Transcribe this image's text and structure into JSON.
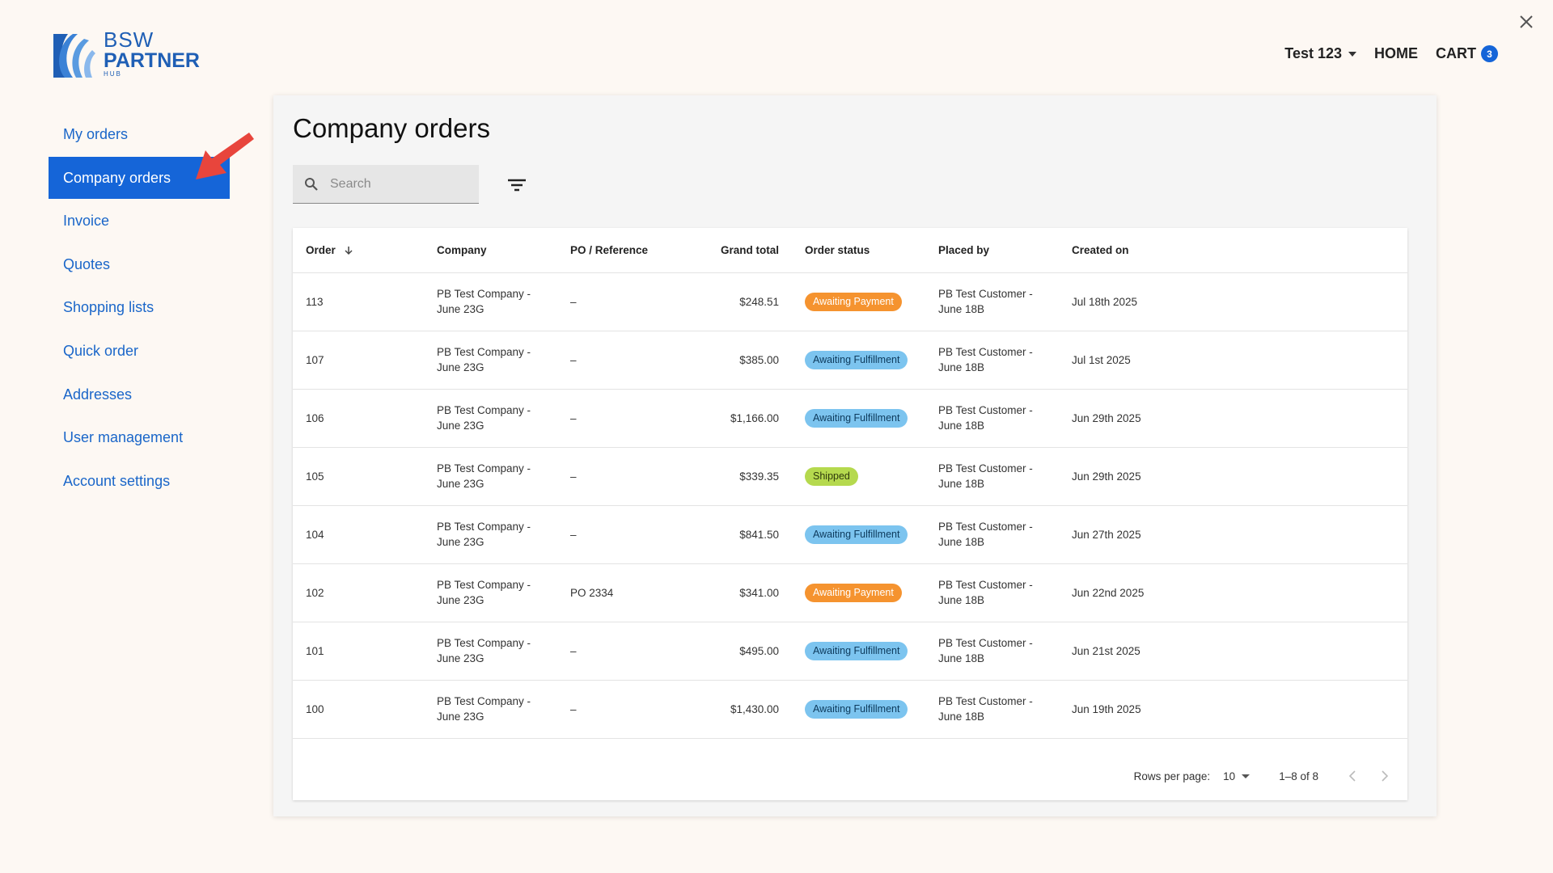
{
  "logo": {
    "line1": "BSW",
    "line2": "PARTNER",
    "line3": "HUB"
  },
  "header": {
    "user_name": "Test 123",
    "home_label": "HOME",
    "cart_label": "CART",
    "cart_count": "3"
  },
  "sidebar": {
    "items": [
      {
        "label": "My orders",
        "active": false
      },
      {
        "label": "Company orders",
        "active": true
      },
      {
        "label": "Invoice",
        "active": false
      },
      {
        "label": "Quotes",
        "active": false
      },
      {
        "label": "Shopping lists",
        "active": false
      },
      {
        "label": "Quick order",
        "active": false
      },
      {
        "label": "Addresses",
        "active": false
      },
      {
        "label": "User management",
        "active": false
      },
      {
        "label": "Account settings",
        "active": false
      }
    ]
  },
  "main": {
    "title": "Company orders",
    "search": {
      "placeholder": "Search",
      "value": ""
    },
    "table": {
      "columns": [
        "Order",
        "Company",
        "PO / Reference",
        "Grand total",
        "Order status",
        "Placed by",
        "Created on"
      ],
      "rows": [
        {
          "order": "113",
          "company": "PB Test Company - June 23G",
          "po": "–",
          "total": "$248.51",
          "status": "Awaiting Payment",
          "status_type": "awaiting-payment",
          "placed_by": "PB Test Customer - June 18B",
          "created": "Jul 18th 2025"
        },
        {
          "order": "107",
          "company": "PB Test Company - June 23G",
          "po": "–",
          "total": "$385.00",
          "status": "Awaiting Fulfillment",
          "status_type": "awaiting-fulfillment",
          "placed_by": "PB Test Customer - June 18B",
          "created": "Jul 1st 2025"
        },
        {
          "order": "106",
          "company": "PB Test Company - June 23G",
          "po": "–",
          "total": "$1,166.00",
          "status": "Awaiting Fulfillment",
          "status_type": "awaiting-fulfillment",
          "placed_by": "PB Test Customer - June 18B",
          "created": "Jun 29th 2025"
        },
        {
          "order": "105",
          "company": "PB Test Company - June 23G",
          "po": "–",
          "total": "$339.35",
          "status": "Shipped",
          "status_type": "shipped",
          "placed_by": "PB Test Customer - June 18B",
          "created": "Jun 29th 2025"
        },
        {
          "order": "104",
          "company": "PB Test Company - June 23G",
          "po": "–",
          "total": "$841.50",
          "status": "Awaiting Fulfillment",
          "status_type": "awaiting-fulfillment",
          "placed_by": "PB Test Customer - June 18B",
          "created": "Jun 27th 2025"
        },
        {
          "order": "102",
          "company": "PB Test Company - June 23G",
          "po": "PO 2334",
          "total": "$341.00",
          "status": "Awaiting Payment",
          "status_type": "awaiting-payment",
          "placed_by": "PB Test Customer - June 18B",
          "created": "Jun 22nd 2025"
        },
        {
          "order": "101",
          "company": "PB Test Company - June 23G",
          "po": "–",
          "total": "$495.00",
          "status": "Awaiting Fulfillment",
          "status_type": "awaiting-fulfillment",
          "placed_by": "PB Test Customer - June 18B",
          "created": "Jun 21st 2025"
        },
        {
          "order": "100",
          "company": "PB Test Company - June 23G",
          "po": "–",
          "total": "$1,430.00",
          "status": "Awaiting Fulfillment",
          "status_type": "awaiting-fulfillment",
          "placed_by": "PB Test Customer - June 18B",
          "created": "Jun 19th 2025"
        }
      ]
    },
    "pagination": {
      "rows_per_page_label": "Rows per page:",
      "rows_per_page_value": "10",
      "range_text": "1–8 of 8"
    }
  },
  "colors": {
    "accent": "#1565d8",
    "link": "#1a66c9",
    "awaiting_payment": "#f5932f",
    "awaiting_fulfillment": "#7cc4ef",
    "shipped": "#b5d94e",
    "annotation_arrow": "#e8453c"
  },
  "icons": {
    "close": "close-icon",
    "search": "search-icon",
    "filter": "filter-icon",
    "sort": "arrow-down-icon",
    "prev": "chevron-left-icon",
    "next": "chevron-right-icon"
  }
}
